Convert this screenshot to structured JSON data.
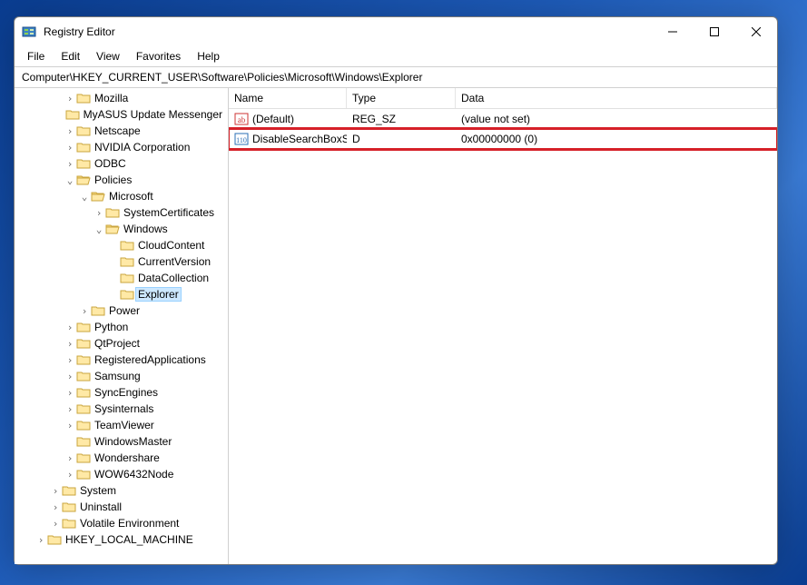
{
  "window": {
    "title": "Registry Editor"
  },
  "menu": {
    "file": "File",
    "edit": "Edit",
    "view": "View",
    "favorites": "Favorites",
    "help": "Help"
  },
  "address": "Computer\\HKEY_CURRENT_USER\\Software\\Policies\\Microsoft\\Windows\\Explorer",
  "columns": {
    "name": "Name",
    "type": "Type",
    "data": "Data"
  },
  "values": [
    {
      "icon": "string",
      "name": "(Default)",
      "type": "REG_SZ",
      "data": "(value not set)",
      "highlight": false
    },
    {
      "icon": "dword",
      "name": "DisableSearchBoxSuggestions",
      "type": "D",
      "data": "0x00000000 (0)",
      "highlight": true
    }
  ],
  "tree": [
    {
      "depth": 1,
      "expand": "closed",
      "label": "Mozilla",
      "sel": false
    },
    {
      "depth": 1,
      "expand": "none",
      "label": "MyASUS Update Messenger",
      "sel": false
    },
    {
      "depth": 1,
      "expand": "closed",
      "label": "Netscape",
      "sel": false
    },
    {
      "depth": 1,
      "expand": "closed",
      "label": "NVIDIA Corporation",
      "sel": false
    },
    {
      "depth": 1,
      "expand": "closed",
      "label": "ODBC",
      "sel": false
    },
    {
      "depth": 1,
      "expand": "open",
      "label": "Policies",
      "sel": false
    },
    {
      "depth": 2,
      "expand": "open",
      "label": "Microsoft",
      "sel": false
    },
    {
      "depth": 3,
      "expand": "closed",
      "label": "SystemCertificates",
      "sel": false
    },
    {
      "depth": 3,
      "expand": "open",
      "label": "Windows",
      "sel": false
    },
    {
      "depth": 4,
      "expand": "none",
      "label": "CloudContent",
      "sel": false
    },
    {
      "depth": 4,
      "expand": "none",
      "label": "CurrentVersion",
      "sel": false
    },
    {
      "depth": 4,
      "expand": "none",
      "label": "DataCollection",
      "sel": false
    },
    {
      "depth": 4,
      "expand": "none",
      "label": "Explorer",
      "sel": true
    },
    {
      "depth": 2,
      "expand": "closed",
      "label": "Power",
      "sel": false
    },
    {
      "depth": 1,
      "expand": "closed",
      "label": "Python",
      "sel": false
    },
    {
      "depth": 1,
      "expand": "closed",
      "label": "QtProject",
      "sel": false
    },
    {
      "depth": 1,
      "expand": "closed",
      "label": "RegisteredApplications",
      "sel": false
    },
    {
      "depth": 1,
      "expand": "closed",
      "label": "Samsung",
      "sel": false
    },
    {
      "depth": 1,
      "expand": "closed",
      "label": "SyncEngines",
      "sel": false
    },
    {
      "depth": 1,
      "expand": "closed",
      "label": "Sysinternals",
      "sel": false
    },
    {
      "depth": 1,
      "expand": "closed",
      "label": "TeamViewer",
      "sel": false
    },
    {
      "depth": 1,
      "expand": "none",
      "label": "WindowsMaster",
      "sel": false
    },
    {
      "depth": 1,
      "expand": "closed",
      "label": "Wondershare",
      "sel": false
    },
    {
      "depth": 1,
      "expand": "closed",
      "label": "WOW6432Node",
      "sel": false
    },
    {
      "depth": 0,
      "expand": "closed",
      "label": "System",
      "sel": false
    },
    {
      "depth": 0,
      "expand": "closed",
      "label": "Uninstall",
      "sel": false
    },
    {
      "depth": 0,
      "expand": "closed",
      "label": "Volatile Environment",
      "sel": false
    },
    {
      "depth": -1,
      "expand": "closed",
      "label": "HKEY_LOCAL_MACHINE",
      "sel": false
    }
  ]
}
